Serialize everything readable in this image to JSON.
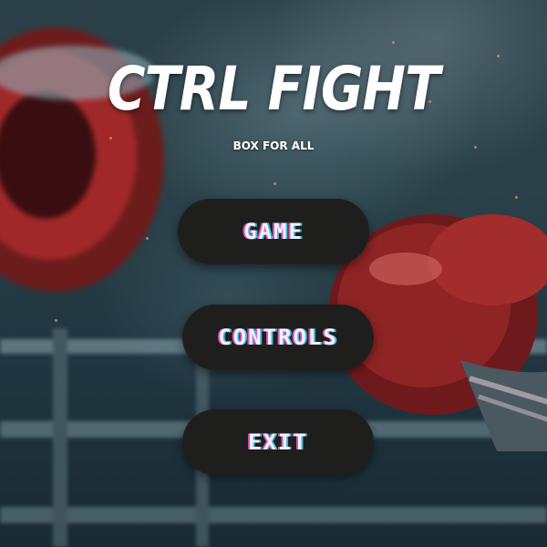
{
  "game": {
    "title": "CTRL FIGHT",
    "subtitle": "BOX FOR ALL"
  },
  "menu": {
    "items": [
      {
        "label": "GAME"
      },
      {
        "label": "CONTROLS"
      },
      {
        "label": "EXIT"
      }
    ]
  },
  "colors": {
    "button_bg": "#1e1f1c",
    "button_text": "#eef2ff",
    "glow_pink": "#ff5ac8",
    "glow_cyan": "#50d2ff",
    "glove_red": "#8e2424"
  }
}
